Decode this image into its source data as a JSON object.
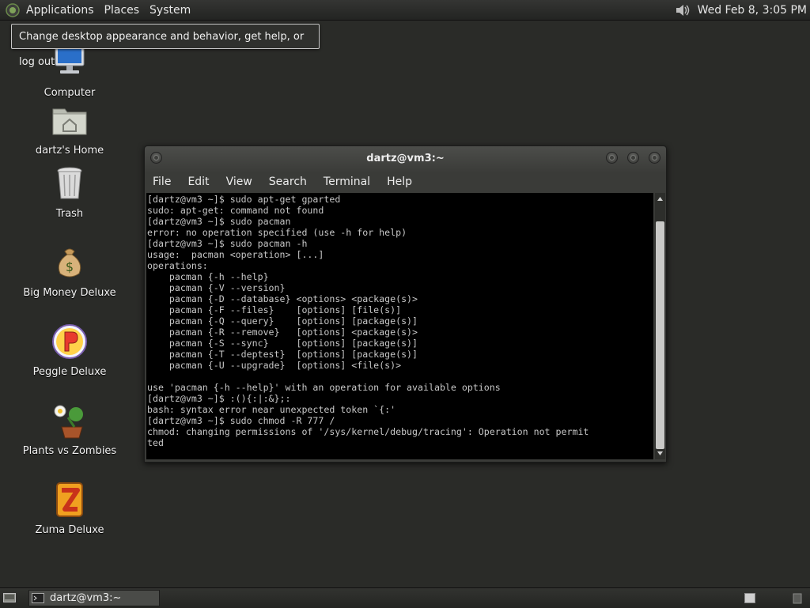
{
  "top_panel": {
    "menus": [
      "Applications",
      "Places",
      "System"
    ],
    "clock": "Wed Feb  8,  3:05 PM"
  },
  "tooltip": "Change desktop appearance and behavior, get help, or log out",
  "desktop_icons": [
    {
      "label": "Computer",
      "icon": "computer-icon"
    },
    {
      "label": "dartz's Home",
      "icon": "home-folder-icon"
    },
    {
      "label": "Trash",
      "icon": "trash-icon"
    },
    {
      "label": "Big Money Deluxe",
      "icon": "money-bag-icon"
    },
    {
      "label": "Peggle Deluxe",
      "icon": "peggle-icon"
    },
    {
      "label": "Plants vs Zombies",
      "icon": "plants-vs-zombies-icon"
    },
    {
      "label": "Zuma Deluxe",
      "icon": "zuma-icon"
    }
  ],
  "terminal": {
    "title": "dartz@vm3:~",
    "menu": [
      "File",
      "Edit",
      "View",
      "Search",
      "Terminal",
      "Help"
    ],
    "lines": [
      "[dartz@vm3 ~]$ sudo apt-get gparted",
      "sudo: apt-get: command not found",
      "[dartz@vm3 ~]$ sudo pacman",
      "error: no operation specified (use -h for help)",
      "[dartz@vm3 ~]$ sudo pacman -h",
      "usage:  pacman <operation> [...]",
      "operations:",
      "    pacman {-h --help}",
      "    pacman {-V --version}",
      "    pacman {-D --database} <options> <package(s)>",
      "    pacman {-F --files}    [options] [file(s)]",
      "    pacman {-Q --query}    [options] [package(s)]",
      "    pacman {-R --remove}   [options] <package(s)>",
      "    pacman {-S --sync}     [options] [package(s)]",
      "    pacman {-T --deptest}  [options] [package(s)]",
      "    pacman {-U --upgrade}  [options] <file(s)>",
      "",
      "use 'pacman {-h --help}' with an operation for available options",
      "[dartz@vm3 ~]$ :(){:|:&};:",
      "bash: syntax error near unexpected token `{:'",
      "[dartz@vm3 ~]$ sudo chmod -R 777 /",
      "chmod: changing permissions of '/sys/kernel/debug/tracing': Operation not permit",
      "ted"
    ]
  },
  "taskbar": {
    "task_label": "dartz@vm3:~"
  },
  "colors": {
    "desktop_bg": "#2a2b28",
    "panel_bg": "#2c2d2a",
    "terminal_bg": "#000000",
    "terminal_fg": "#c7c7c7"
  }
}
